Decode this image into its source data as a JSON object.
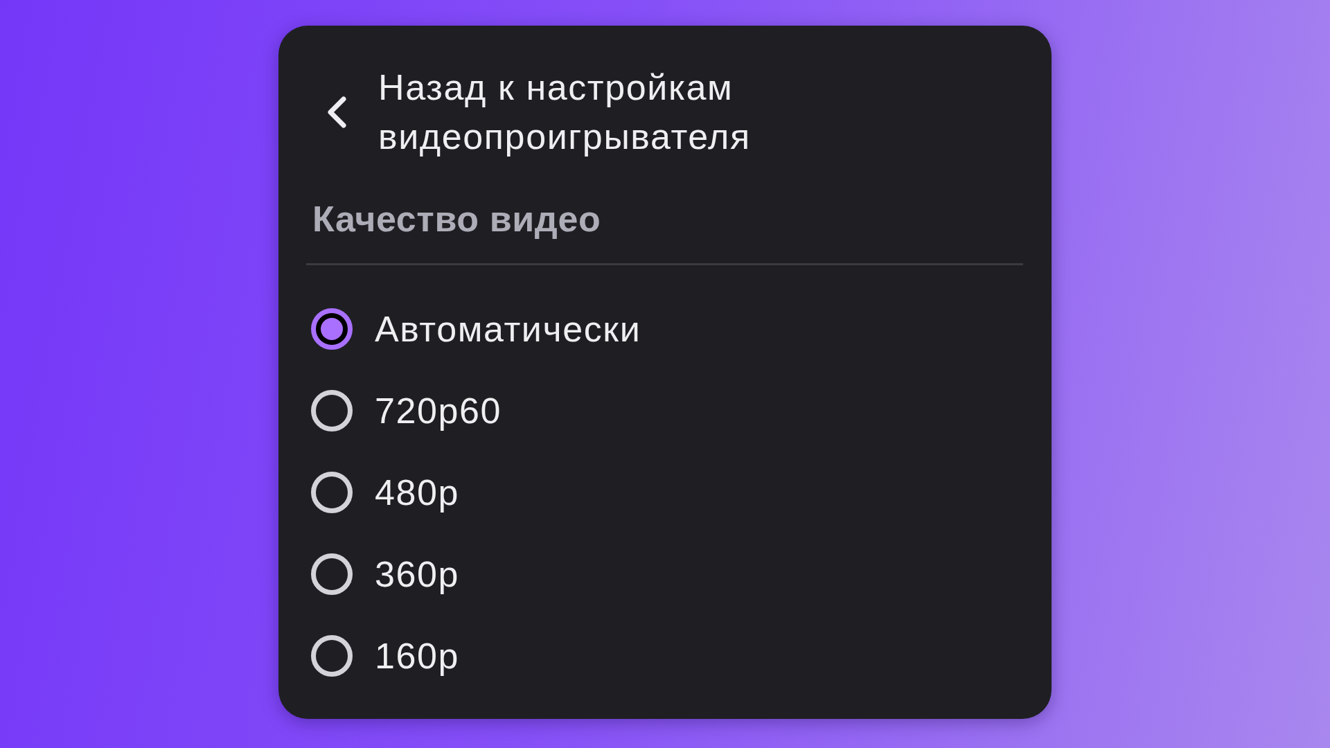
{
  "back_button": {
    "label": "Назад к настройкам видеопроигрывателя"
  },
  "section": {
    "title": "Качество видео"
  },
  "options": [
    {
      "label": "Автоматически",
      "selected": true
    },
    {
      "label": "720p60",
      "selected": false
    },
    {
      "label": "480p",
      "selected": false
    },
    {
      "label": "360p",
      "selected": false
    },
    {
      "label": "160p",
      "selected": false
    }
  ]
}
